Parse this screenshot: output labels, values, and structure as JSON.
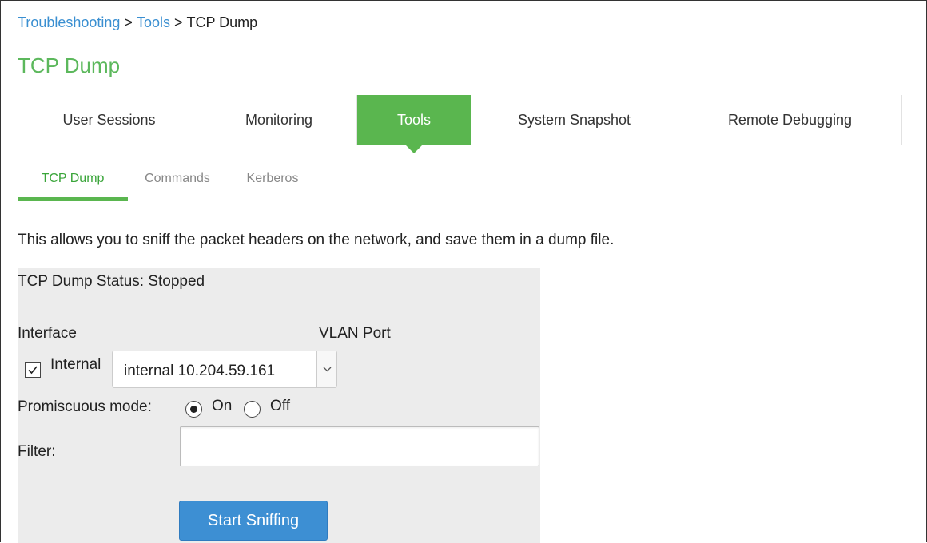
{
  "breadcrumb": {
    "items": [
      "Troubleshooting",
      "Tools"
    ],
    "separator": ">",
    "current": "TCP Dump"
  },
  "page_title": "TCP Dump",
  "main_tabs": [
    {
      "label": "User Sessions",
      "active": false
    },
    {
      "label": "Monitoring",
      "active": false
    },
    {
      "label": "Tools",
      "active": true
    },
    {
      "label": "System Snapshot",
      "active": false
    },
    {
      "label": "Remote Debugging",
      "active": false
    }
  ],
  "sub_tabs": [
    {
      "label": "TCP Dump",
      "active": true
    },
    {
      "label": "Commands",
      "active": false
    },
    {
      "label": "Kerberos",
      "active": false
    }
  ],
  "description": "This allows you to sniff the packet headers on the network, and save them in a dump file.",
  "form": {
    "status_label": "TCP Dump Status:",
    "status_value": "Stopped",
    "interface_label": "Interface",
    "vlan_port_label": "VLAN Port",
    "internal_checkbox": {
      "label": "Internal",
      "checked": true
    },
    "interface_select": {
      "value": "internal 10.204.59.161"
    },
    "promiscuous_label": "Promiscuous mode:",
    "promiscuous_options": [
      {
        "label": "On",
        "checked": true
      },
      {
        "label": "Off",
        "checked": false
      }
    ],
    "filter_label": "Filter:",
    "filter_value": "",
    "start_button_label": "Start Sniffing"
  },
  "colors": {
    "link": "#3a8fd1",
    "accent_green": "#5ab64f",
    "title_green": "#5cb85c",
    "button_blue": "#3d8fd3",
    "panel_bg": "#ececec"
  }
}
